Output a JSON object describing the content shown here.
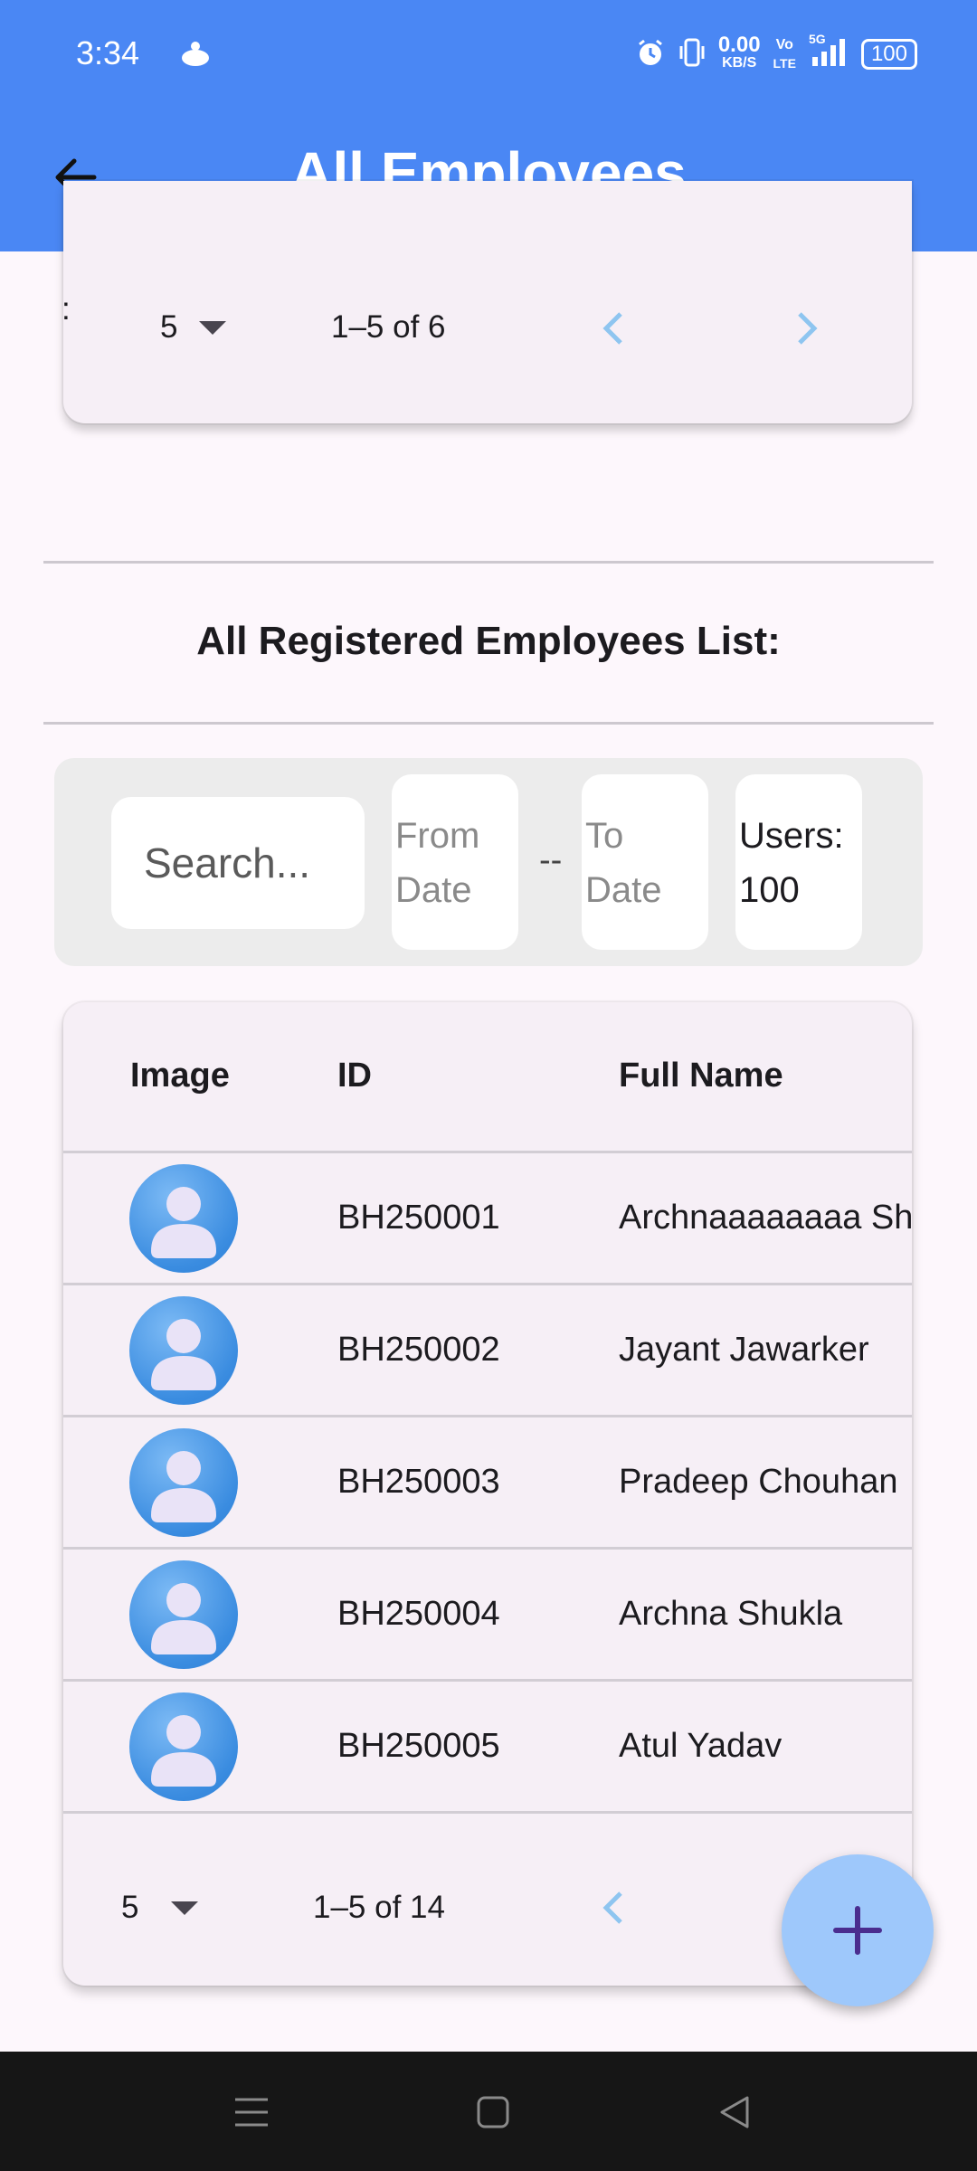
{
  "status_bar": {
    "time": "3:34",
    "net_speed_value": "0.00",
    "net_speed_unit": "KB/S",
    "volte_top": "Vo",
    "volte_bottom": "LTE",
    "network_label": "5G",
    "battery": "100"
  },
  "app_bar": {
    "title": "All Employees"
  },
  "top_pagination": {
    "colon": ":",
    "rows_per_page": "5",
    "range": "1–5 of 6"
  },
  "section": {
    "title": "All Registered Employees List:"
  },
  "filters": {
    "search_placeholder": "Search...",
    "from_date": "From Date",
    "date_separator": "--",
    "to_date": "To Date",
    "users_label": "Users: 100"
  },
  "table": {
    "headers": {
      "image": "Image",
      "id": "ID",
      "full_name": "Full Name"
    },
    "rows": [
      {
        "id": "BH250001",
        "name": "Archnaaaaaaaa Shukla"
      },
      {
        "id": "BH250002",
        "name": "Jayant Jawarker"
      },
      {
        "id": "BH250003",
        "name": "Pradeep Chouhan"
      },
      {
        "id": "BH250004",
        "name": "Archna Shukla"
      },
      {
        "id": "BH250005",
        "name": "Atul Yadav"
      }
    ]
  },
  "bottom_pagination": {
    "rows_per_page": "5",
    "range": "1–5 of 14"
  },
  "icons": {
    "back": "arrow-left-icon",
    "dropdown": "caret-down-icon",
    "prev": "chevron-left-icon",
    "next": "chevron-right-icon",
    "fab": "plus-icon",
    "avatar": "user-avatar-icon"
  },
  "colors": {
    "app_bar": "#4a87f4",
    "background": "#fdf7fc",
    "card": "#f6eff6",
    "fab": "#9ec8fb",
    "fab_icon": "#4a2d8f",
    "chevron": "#8ec5f0"
  }
}
